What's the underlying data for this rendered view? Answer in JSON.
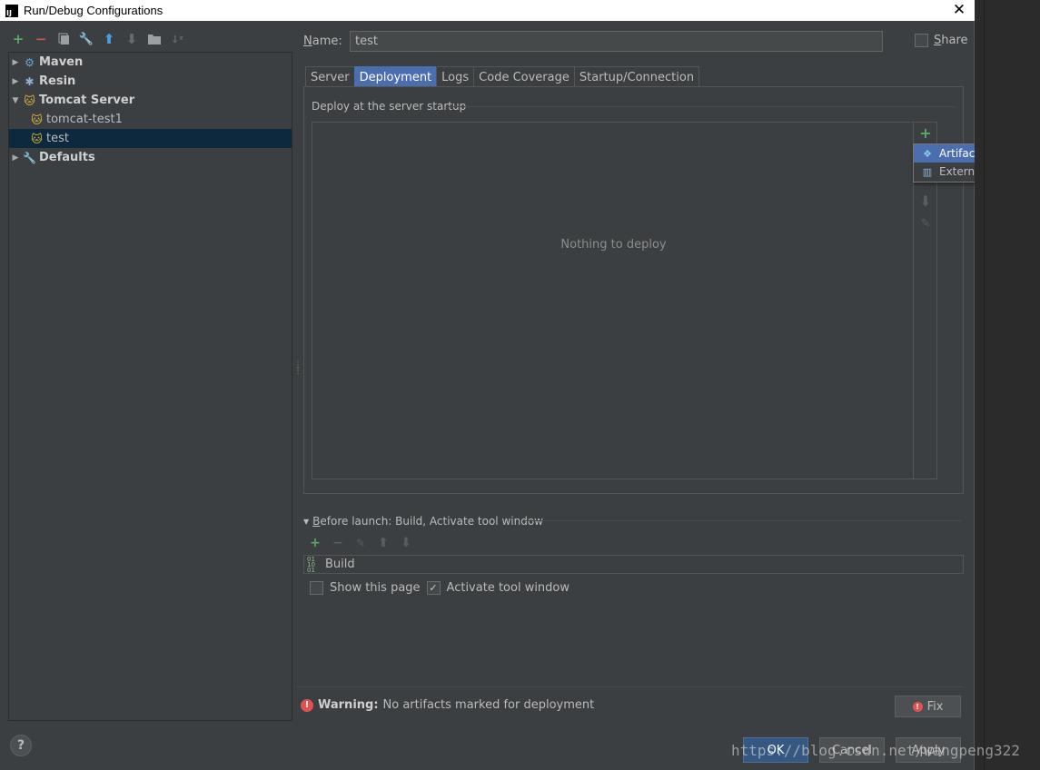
{
  "window": {
    "title": "Run/Debug Configurations",
    "app_icon": "IJ",
    "close": "✕"
  },
  "left_toolbar": [
    "+",
    "−",
    "⧉",
    "🔧",
    "⬆",
    "⬇",
    "📁",
    "↓ᵃz"
  ],
  "tree": {
    "items": [
      {
        "label": "Maven",
        "level": 0,
        "expanded": false,
        "icon": "maven-icon"
      },
      {
        "label": "Resin",
        "level": 0,
        "expanded": false,
        "icon": "resin-icon"
      },
      {
        "label": "Tomcat Server",
        "level": 0,
        "expanded": true,
        "icon": "tomcat-icon"
      },
      {
        "label": "tomcat-test1",
        "level": 1,
        "icon": "tomcat-icon"
      },
      {
        "label": "test",
        "level": 1,
        "icon": "tomcat-icon",
        "selected": true
      },
      {
        "label": "Defaults",
        "level": 0,
        "expanded": false,
        "icon": "wrench-icon"
      }
    ]
  },
  "name": {
    "label_underlined": "N",
    "label_rest": "ame:",
    "value": "test"
  },
  "share": {
    "label_underlined": "S",
    "label_rest": "hare",
    "checked": false
  },
  "tabs": [
    "Server",
    "Deployment",
    "Logs",
    "Code Coverage",
    "Startup/Connection"
  ],
  "active_tab": 1,
  "deployment": {
    "section_label": "Deploy at the server startup",
    "empty_text": "Nothing to deploy",
    "add": "+",
    "popup": [
      {
        "label": "Artifact...",
        "icon": "artifact-icon",
        "highlighted": true
      },
      {
        "label": "External Source...",
        "icon": "external-source-icon",
        "highlighted": false
      }
    ]
  },
  "before_launch": {
    "label_underlined": "B",
    "label_rest": "efore launch: Build, Activate tool window",
    "tasks": [
      "Build"
    ],
    "show_this_page": {
      "label": "Show this page",
      "checked": false
    },
    "activate_tool_window": {
      "label": "Activate tool window",
      "checked": true
    }
  },
  "warning": {
    "bold": "Warning:",
    "text": "No artifacts marked for deployment",
    "fix_label": "Fix"
  },
  "buttons": {
    "ok": "OK",
    "cancel": "Cancel",
    "apply": "Apply",
    "help": "?"
  },
  "watermark": "https://blog.csdn.net/wangpeng322",
  "colors": {
    "accent": "#4b6eaf",
    "add": "#59a869",
    "remove": "#c75450",
    "selection": "#0d293e"
  }
}
